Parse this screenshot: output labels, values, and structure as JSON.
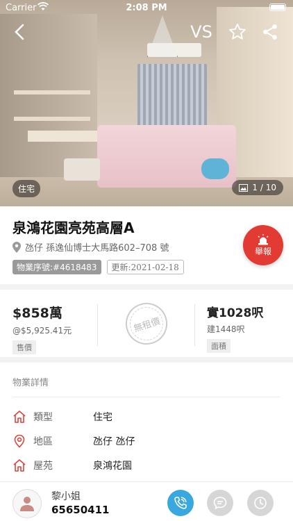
{
  "status": {
    "carrier": "Carrier",
    "time": "2:08 PM"
  },
  "topbar": {
    "vs_label": "VS",
    "icons": [
      "back-icon",
      "star-icon",
      "share-icon"
    ]
  },
  "photo": {
    "type_tag": "住宅",
    "counter": "1 / 10"
  },
  "listing": {
    "title": "泉鴻花園亮苑高層A",
    "address": "氹仔 孫逸仙博士大馬路602–708 號",
    "serial": "物業序號:#4618483",
    "updated": "更新:2021-02-18"
  },
  "report": {
    "label": "舉報"
  },
  "price": {
    "amount": "$858",
    "unit": "萬",
    "unit_price": "@$5,925.41元",
    "tag": "售價"
  },
  "rent_stamp": "無租價",
  "area": {
    "actual": "實1028呎",
    "gross": "建1448呎",
    "tag": "面積"
  },
  "details": {
    "section_title": "物業詳情",
    "rows": [
      {
        "label": "類型",
        "value": "住宅",
        "icon": "home-icon"
      },
      {
        "label": "地區",
        "value": "氹仔 氹仔",
        "icon": "location-icon"
      },
      {
        "label": "屋苑",
        "value": "泉鴻花園",
        "icon": "home-icon"
      }
    ]
  },
  "agent": {
    "name": "黎小姐",
    "phone": "65650411"
  },
  "colors": {
    "accent_red": "#e23b33",
    "call_blue": "#3aa8e0"
  }
}
